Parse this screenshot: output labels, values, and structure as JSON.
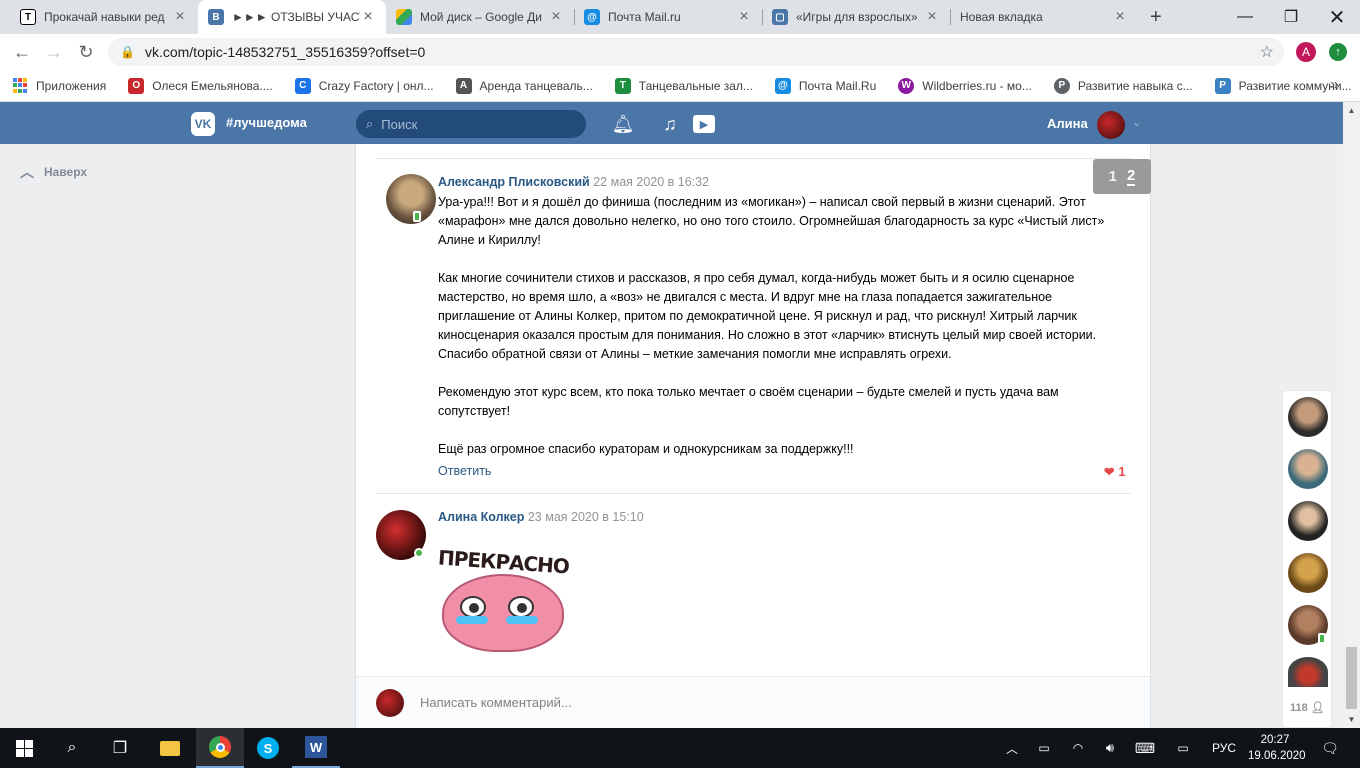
{
  "browser": {
    "tabs": [
      {
        "title": "Прокачай навыки ред",
        "icon": "T",
        "color": "#000000"
      },
      {
        "title": "►►► ОТЗЫВЫ УЧАСТ",
        "icon": "VK",
        "color": "#4a76a8"
      },
      {
        "title": "Мой диск – Google Ди",
        "icon": "drive",
        "color": "#34a853"
      },
      {
        "title": "Почта Mail.ru",
        "icon": "@",
        "color": "#168de2"
      },
      {
        "title": "«Игры для взрослых»",
        "icon": "chat",
        "color": "#4a76a8"
      },
      {
        "title": "Новая вкладка",
        "icon": "",
        "color": ""
      }
    ],
    "new_tab": "+",
    "url": "vk.com/topic-148532751_35516359?offset=0",
    "profile_initial": "А",
    "bookmarks": [
      {
        "label": "Приложения",
        "icon": "apps-icon",
        "color": "#4285f4"
      },
      {
        "label": "Олеся Емельянова....",
        "icon": "О",
        "color": "#c8282a"
      },
      {
        "label": "Crazy Factory | онл...",
        "icon": "C",
        "color": "#1a73e8"
      },
      {
        "label": "Аренда танцеваль...",
        "icon": "A",
        "color": "#555555"
      },
      {
        "label": "Танцевальные зал...",
        "icon": "Т",
        "color": "#1e8e3e"
      },
      {
        "label": "Почта Mail.Ru",
        "icon": "@",
        "color": "#168de2"
      },
      {
        "label": "Wildberries.ru - мо...",
        "icon": "W",
        "color": "#8b1a9e"
      },
      {
        "label": "Развитие навыка с...",
        "icon": "Р",
        "color": "#5f6368"
      },
      {
        "label": "Развитие коммуни...",
        "icon": "Р",
        "color": "#3b82c4"
      }
    ],
    "more_bookmarks": "»"
  },
  "vk": {
    "logo": "VK",
    "hashtag": "#лучшедома",
    "search_placeholder": "Поиск",
    "user_name": "Алина",
    "back_to_top": "Наверх",
    "pages": [
      "1",
      "2"
    ]
  },
  "comments": [
    {
      "author": "Александр Плисковский",
      "date": "22 мая 2020 в 16:32",
      "paragraphs": [
        "Ура-ура!!! Вот и я дошёл до финиша (последним из «могикан») – написал свой первый в жизни сценарий. Этот «марафон» мне дался довольно нелегко, но оно того стоило. Огромнейшая благодарность за курс «Чистый лист» Алине и Кириллу!",
        "Как многие сочинители стихов и рассказов, я про себя думал, когда-нибудь может быть и я осилю сценарное мастерство, но время шло, а «воз» не двигался с места. И вдруг мне на глаза попадается зажигательное приглашение от Алины Колкер, притом по демократичной цене. Я рискнул и рад, что рискнул! Хитрый ларчик киносценария оказался простым для понимания. Но сложно в этот «ларчик» втиснуть целый мир своей истории. Спасибо обратной связи от Алины – меткие замечания помогли мне исправлять огрехи.",
        "Рекомендую этот курс всем, кто пока только мечтает о своём сценарии – будьте смелей и пусть удача вам сопутствует!",
        "Ещё раз огромное спасибо кураторам и однокурсникам за поддержку!!!"
      ],
      "reply_label": "Ответить",
      "likes": "1"
    },
    {
      "author": "Алина Колкер",
      "date": "23 мая 2020 в 15:10",
      "sticker_text": "ПРЕКРАСНО"
    }
  ],
  "composer": {
    "placeholder": "Написать комментарий..."
  },
  "chat": {
    "online_count": "118"
  },
  "taskbar": {
    "language": "РУС",
    "time": "20:27",
    "date": "19.06.2020"
  }
}
